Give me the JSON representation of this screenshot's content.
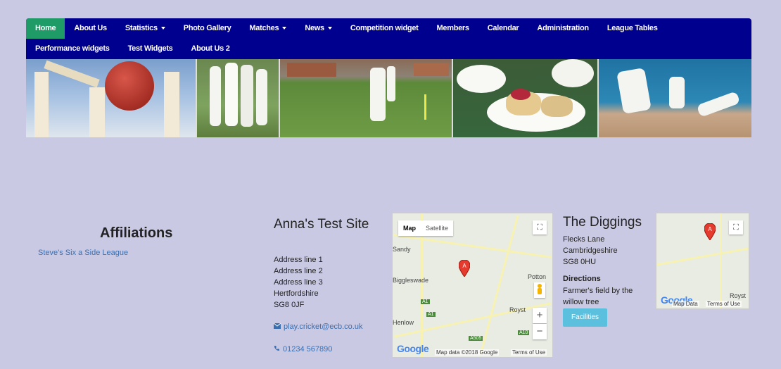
{
  "nav": {
    "row1": [
      {
        "label": "Home",
        "active": true,
        "dropdown": false
      },
      {
        "label": "About Us",
        "dropdown": false
      },
      {
        "label": "Statistics",
        "dropdown": true
      },
      {
        "label": "Photo Gallery",
        "dropdown": false
      },
      {
        "label": "Matches",
        "dropdown": true
      },
      {
        "label": "News",
        "dropdown": true
      },
      {
        "label": "Competition widget",
        "dropdown": false
      },
      {
        "label": "Members",
        "dropdown": false
      },
      {
        "label": "Calendar",
        "dropdown": false
      },
      {
        "label": "Administration",
        "dropdown": false
      },
      {
        "label": "League Tables",
        "dropdown": false
      }
    ],
    "row2": [
      {
        "label": "Performance widgets",
        "dropdown": false
      },
      {
        "label": "Test Widgets",
        "dropdown": false
      },
      {
        "label": "About Us 2",
        "dropdown": false
      }
    ]
  },
  "colors": {
    "nav_bg": "#00008e",
    "active_tab": "#1f9b68",
    "link": "#3a6fb0",
    "facilities_btn": "#5bc0de"
  },
  "affiliations": {
    "title": "Affiliations",
    "link": "Steve's Six a Side League"
  },
  "site": {
    "title": "Anna's Test Site",
    "address": [
      "Address line 1",
      "Address line 2",
      "Address line 3",
      "Hertfordshire",
      "SG8 0JF"
    ],
    "email": "play.cricket@ecb.co.uk",
    "phone": "01234 567890"
  },
  "map1": {
    "toggle_map": "Map",
    "toggle_satellite": "Satellite",
    "marker": "A",
    "places": [
      "Sandy",
      "Biggleswade",
      "Royst",
      "Henlow",
      "Potton"
    ],
    "roads": [
      "A1",
      "A1",
      "A505",
      "A10"
    ],
    "google": "Google",
    "attribution": "Map data ©2018 Google",
    "terms": "Terms of Use",
    "zoom_in": "+",
    "zoom_out": "−"
  },
  "ground": {
    "name": "The Diggings",
    "address": [
      "Flecks Lane",
      "Cambridgeshire",
      "SG8 0HU"
    ],
    "directions_title": "Directions",
    "directions": "Farmer's field by the willow tree",
    "facilities_button": "Facilities"
  },
  "map2": {
    "marker": "A",
    "place": "Royst",
    "google": "Google",
    "attribution": "Map Data",
    "terms": "Terms of Use"
  },
  "icons": [
    "envelope-icon",
    "phone-icon",
    "caret-down-icon",
    "fullscreen-icon",
    "map-pin-icon",
    "pegman-icon"
  ]
}
